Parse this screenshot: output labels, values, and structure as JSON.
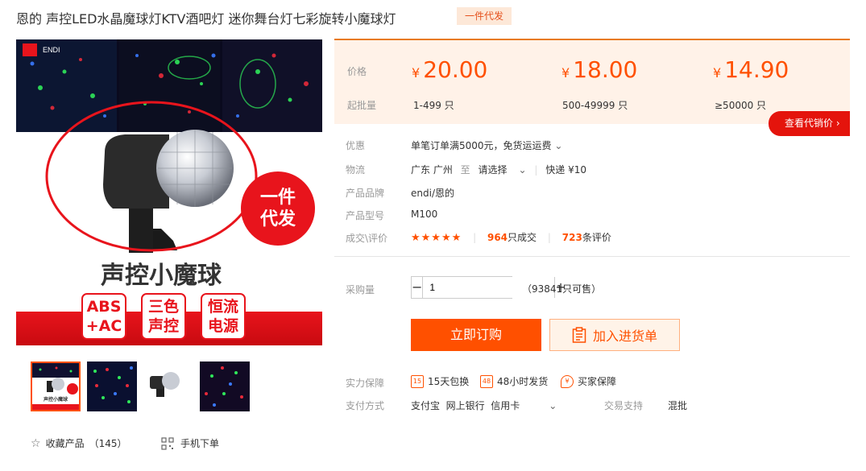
{
  "title": "恩的 声控LED水晶魔球灯KTV酒吧灯 迷你舞台灯七彩旋转小魔球灯",
  "tag": "一件代发",
  "main_image": {
    "banner_text": "声控小魔球",
    "badge_text": [
      "一件",
      "代发"
    ],
    "features": [
      [
        "ABS",
        "+AC"
      ],
      [
        "三色",
        "声控"
      ],
      [
        "恒流",
        "电源"
      ]
    ],
    "brand_logo": "ENDI"
  },
  "thumbs_mini_text": "声控小魔球",
  "favorites": {
    "icon": "star-outline-icon",
    "label": "收藏产品",
    "count": "（145）"
  },
  "mobile_order": {
    "icon": "qr-code-icon",
    "label": "手机下单"
  },
  "pricing": {
    "price_label": "价格",
    "moq_label": "起批量",
    "currency": "¥",
    "tiers": [
      {
        "price": "20.00",
        "qty": "1-499 只"
      },
      {
        "price": "18.00",
        "qty": "500-49999 只"
      },
      {
        "price": "14.90",
        "qty": "≥50000 只"
      }
    ],
    "agent_button": "查看代销价"
  },
  "info": {
    "discount_label": "优惠",
    "discount_value": "单笔订单满5000元，免货运运费",
    "logistics_label": "物流",
    "logistics_from": "广东 广州",
    "logistics_to": "至",
    "logistics_select": "请选择",
    "logistics_fee": "快递 ¥10",
    "brand_label": "产品品牌",
    "brand_value": "endi/恩的",
    "model_label": "产品型号",
    "model_value": "M100",
    "deals_label": "成交\\评价",
    "stars": "★★★★★",
    "sold_count": "964",
    "sold_suffix": "只成交",
    "review_count": "723",
    "review_suffix": "条评价"
  },
  "purchase": {
    "qty_label": "采购量",
    "qty_value": "1",
    "available": "（93841只可售）",
    "buy_button": "立即订购",
    "cart_button": "加入进货单"
  },
  "guarantee": {
    "label": "实力保障",
    "items": [
      {
        "icon": "15",
        "text": "15天包换"
      },
      {
        "icon": "48",
        "text": "48小时发货"
      },
      {
        "icon": "¥",
        "text": "买家保障"
      }
    ]
  },
  "payment": {
    "label": "支付方式",
    "methods": "支付宝  网上银行  信用卡",
    "trade_label": "交易支持",
    "trade_value": "混批"
  },
  "colors": {
    "accent": "#ff5000",
    "red": "#e4140c",
    "price_bg": "#fff2e8"
  }
}
